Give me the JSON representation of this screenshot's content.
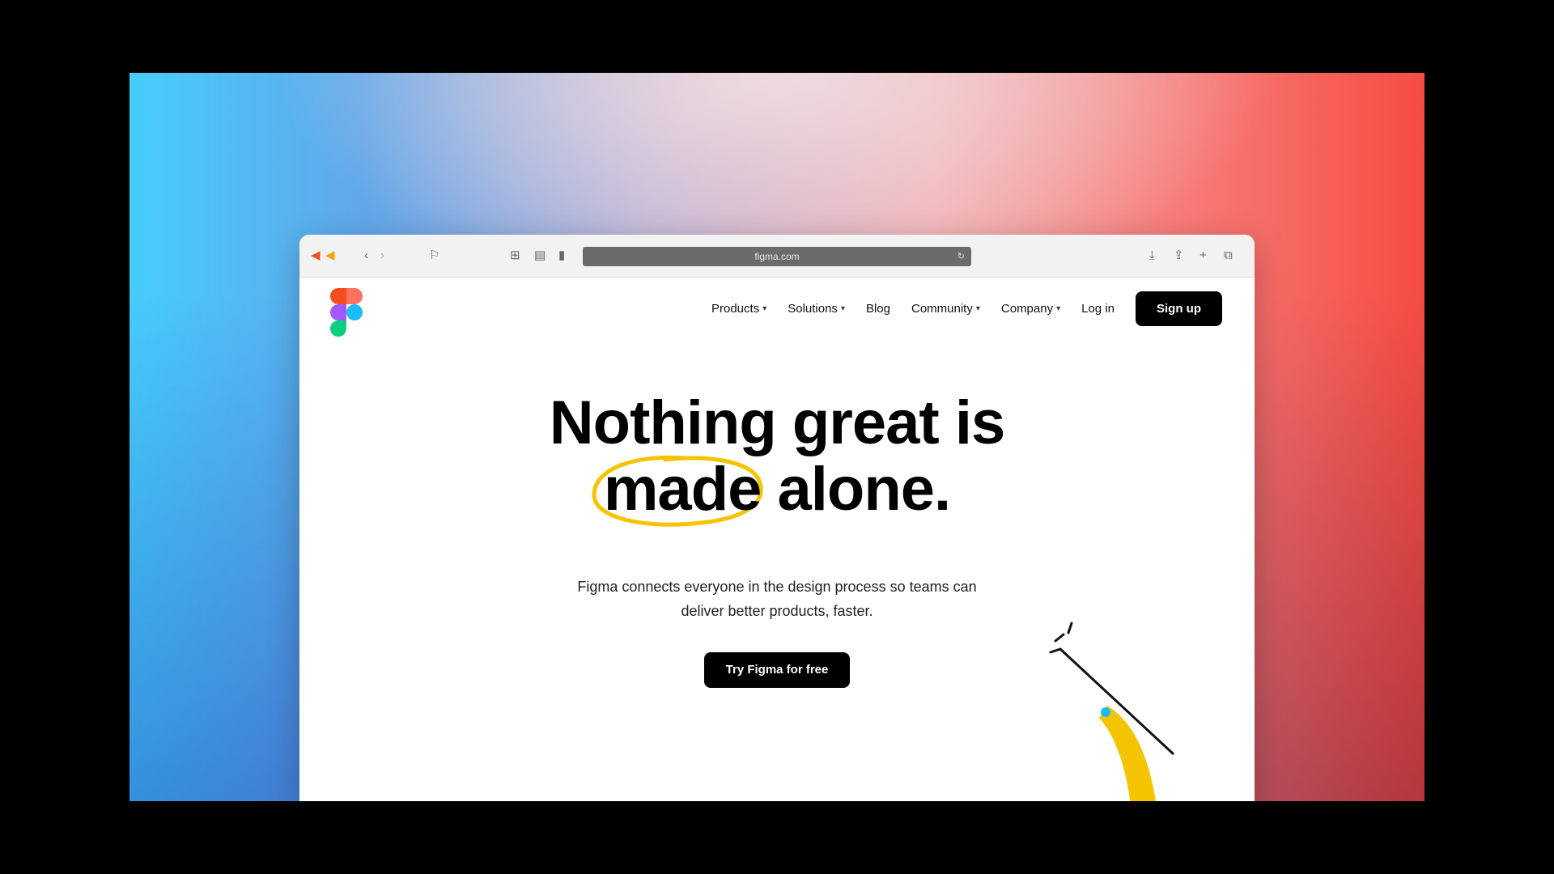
{
  "browser": {
    "address": "figma.com"
  },
  "toolbar_icons": {
    "back": "back-icon",
    "forward": "forward-icon",
    "share": "share-icon",
    "new_tab": "plus-icon"
  },
  "nav": {
    "items": [
      {
        "label": "Products",
        "has_menu": true
      },
      {
        "label": "Solutions",
        "has_menu": true
      },
      {
        "label": "Blog",
        "has_menu": false
      },
      {
        "label": "Community",
        "has_menu": true
      },
      {
        "label": "Company",
        "has_menu": true
      },
      {
        "label": "Log in",
        "has_menu": false
      }
    ],
    "signup_label": "Sign up"
  },
  "hero": {
    "title_line1": "Nothing great is",
    "title_circled": "made",
    "title_rest": " alone.",
    "subtitle": "Figma connects everyone in the design process so teams can deliver better products, faster.",
    "cta_label": "Try Figma for free"
  },
  "colors": {
    "highlight": "#f5c400",
    "logo_red": "#f24e1e",
    "logo_orange": "#ff7262",
    "logo_purple": "#a259ff",
    "logo_blue": "#1abcfe",
    "logo_green": "#0acf83"
  }
}
